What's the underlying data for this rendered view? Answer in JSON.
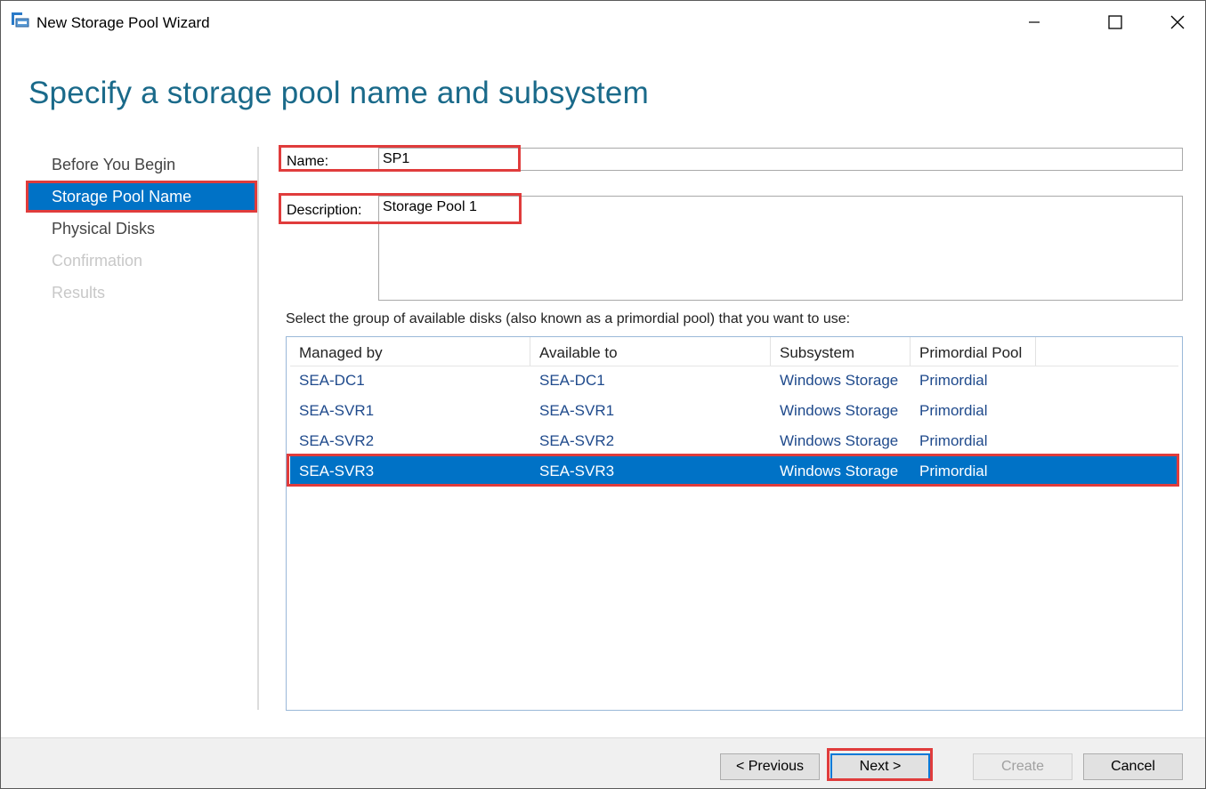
{
  "window": {
    "title": "New Storage Pool Wizard",
    "icon": "storage-pool-icon"
  },
  "page": {
    "title": "Specify a storage pool name and subsystem"
  },
  "nav": {
    "items": [
      {
        "label": "Before You Begin",
        "state": "normal"
      },
      {
        "label": "Storage Pool Name",
        "state": "active"
      },
      {
        "label": "Physical Disks",
        "state": "normal"
      },
      {
        "label": "Confirmation",
        "state": "disabled"
      },
      {
        "label": "Results",
        "state": "disabled"
      }
    ]
  },
  "form": {
    "name_label": "Name:",
    "name_value": "SP1",
    "description_label": "Description:",
    "description_value": "Storage Pool 1",
    "instructions": "Select the group of available disks (also known as a primordial pool) that you want to use:"
  },
  "table": {
    "columns": [
      "Managed by",
      "Available to",
      "Subsystem",
      "Primordial Pool"
    ],
    "rows": [
      {
        "managed_by": "SEA-DC1",
        "available_to": "SEA-DC1",
        "subsystem": "Windows Storage",
        "pool": "Primordial",
        "selected": false
      },
      {
        "managed_by": "SEA-SVR1",
        "available_to": "SEA-SVR1",
        "subsystem": "Windows Storage",
        "pool": "Primordial",
        "selected": false
      },
      {
        "managed_by": "SEA-SVR2",
        "available_to": "SEA-SVR2",
        "subsystem": "Windows Storage",
        "pool": "Primordial",
        "selected": false
      },
      {
        "managed_by": "SEA-SVR3",
        "available_to": "SEA-SVR3",
        "subsystem": "Windows Storage",
        "pool": "Primordial",
        "selected": true
      }
    ]
  },
  "buttons": {
    "previous": "< Previous",
    "next": "Next >",
    "create": "Create",
    "cancel": "Cancel"
  },
  "colors": {
    "accent": "#0072c6",
    "highlight": "#e03c3c",
    "title": "#1a6a8a"
  }
}
